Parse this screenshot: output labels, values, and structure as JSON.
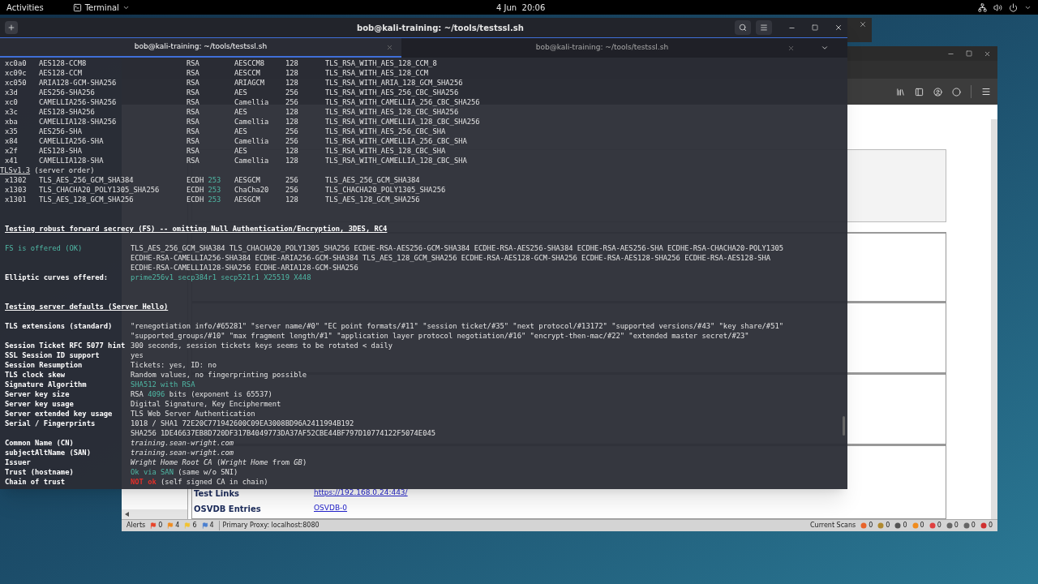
{
  "top_bar": {
    "activities": "Activities",
    "app_menu": "Terminal",
    "clock": "4 Jun  20:06"
  },
  "terminal": {
    "title": "bob@kali-training: ~/tools/testssl.sh",
    "tabs": [
      {
        "title": "bob@kali-training: ~/tools/testssl.sh",
        "selected": true
      },
      {
        "title": "bob@kali-training: ~/tools/testssl.sh",
        "selected": false
      }
    ],
    "lines": [
      {
        "kind": "cipher",
        "hex": "xc0a0",
        "name": "AES128-CCM8",
        "kx": "RSA",
        "enc": "AESCCM8",
        "bits": "128",
        "iana": "TLS_RSA_WITH_AES_128_CCM_8"
      },
      {
        "kind": "cipher",
        "hex": "xc09c",
        "name": "AES128-CCM",
        "kx": "RSA",
        "enc": "AESCCM",
        "bits": "128",
        "iana": "TLS_RSA_WITH_AES_128_CCM"
      },
      {
        "kind": "cipher",
        "hex": "xc050",
        "name": "ARIA128-GCM-SHA256",
        "kx": "RSA",
        "enc": "ARIAGCM",
        "bits": "128",
        "iana": "TLS_RSA_WITH_ARIA_128_GCM_SHA256"
      },
      {
        "kind": "cipher",
        "hex": "x3d",
        "name": "AES256-SHA256",
        "kx": "RSA",
        "enc": "AES",
        "bits": "256",
        "iana": "TLS_RSA_WITH_AES_256_CBC_SHA256"
      },
      {
        "kind": "cipher",
        "hex": "xc0",
        "name": "CAMELLIA256-SHA256",
        "kx": "RSA",
        "enc": "Camellia",
        "bits": "256",
        "iana": "TLS_RSA_WITH_CAMELLIA_256_CBC_SHA256"
      },
      {
        "kind": "cipher",
        "hex": "x3c",
        "name": "AES128-SHA256",
        "kx": "RSA",
        "enc": "AES",
        "bits": "128",
        "iana": "TLS_RSA_WITH_AES_128_CBC_SHA256"
      },
      {
        "kind": "cipher",
        "hex": "xba",
        "name": "CAMELLIA128-SHA256",
        "kx": "RSA",
        "enc": "Camellia",
        "bits": "128",
        "iana": "TLS_RSA_WITH_CAMELLIA_128_CBC_SHA256"
      },
      {
        "kind": "cipher",
        "hex": "x35",
        "name": "AES256-SHA",
        "kx": "RSA",
        "enc": "AES",
        "bits": "256",
        "iana": "TLS_RSA_WITH_AES_256_CBC_SHA"
      },
      {
        "kind": "cipher",
        "hex": "x84",
        "name": "CAMELLIA256-SHA",
        "kx": "RSA",
        "enc": "Camellia",
        "bits": "256",
        "iana": "TLS_RSA_WITH_CAMELLIA_256_CBC_SHA"
      },
      {
        "kind": "cipher",
        "hex": "x2f",
        "name": "AES128-SHA",
        "kx": "RSA",
        "enc": "AES",
        "bits": "128",
        "iana": "TLS_RSA_WITH_AES_128_CBC_SHA"
      },
      {
        "kind": "cipher",
        "hex": "x41",
        "name": "CAMELLIA128-SHA",
        "kx": "RSA",
        "enc": "Camellia",
        "bits": "128",
        "iana": "TLS_RSA_WITH_CAMELLIA_128_CBC_SHA"
      },
      {
        "kind": "label",
        "text": "TLSv1.3",
        "suffix": " (server order)"
      },
      {
        "kind": "cipher",
        "hex": "x1302",
        "name": "TLS_AES_256_GCM_SHA384",
        "kx": "ECDH",
        "curve": "253",
        "enc": "AESGCM",
        "bits": "256",
        "iana": "TLS_AES_256_GCM_SHA384"
      },
      {
        "kind": "cipher",
        "hex": "x1303",
        "name": "TLS_CHACHA20_POLY1305_SHA256",
        "kx": "ECDH",
        "curve": "253",
        "enc": "ChaCha20",
        "bits": "256",
        "iana": "TLS_CHACHA20_POLY1305_SHA256"
      },
      {
        "kind": "cipher",
        "hex": "x1301",
        "name": "TLS_AES_128_GCM_SHA256",
        "kx": "ECDH",
        "curve": "253",
        "enc": "AESGCM",
        "bits": "128",
        "iana": "TLS_AES_128_GCM_SHA256"
      },
      {
        "kind": "blank"
      },
      {
        "kind": "blank"
      },
      {
        "kind": "heading",
        "text": "Testing robust forward secrecy (FS) -- omitting Null Authentication/Encryption, 3DES, RC4"
      },
      {
        "kind": "blank"
      },
      {
        "kind": "kv",
        "key": "FS is offered (OK)",
        "key_highlighted": true,
        "values": [
          [
            {
              "text": "TLS_AES_256_GCM_SHA384 TLS_CHACHA20_POLY1305_SHA256 ECDHE-RSA-AES256-GCM-SHA384 ECDHE-RSA-AES256-SHA384 ECDHE-RSA-AES256-SHA ECDHE-RSA-CHACHA20-POLY1305",
              "kind": "plain"
            }
          ],
          [
            {
              "text": "ECDHE-RSA-CAMELLIA256-SHA384 ECDHE-ARIA256-GCM-SHA384 TLS_AES_128_GCM_SHA256 ECDHE-RSA-AES128-GCM-SHA256 ECDHE-RSA-AES128-SHA256 ECDHE-RSA-AES128-SHA",
              "kind": "plain"
            }
          ],
          [
            {
              "text": "ECDHE-RSA-CAMELLIA128-SHA256 ECDHE-ARIA128-GCM-SHA256",
              "kind": "plain"
            }
          ]
        ]
      },
      {
        "kind": "kv",
        "key": "Elliptic curves offered:",
        "key_highlighted": false,
        "values": [
          [
            {
              "text": "prime256v1 secp384r1 secp521r1 X25519 X448",
              "kind": "good"
            }
          ]
        ]
      },
      {
        "kind": "blank"
      },
      {
        "kind": "blank"
      },
      {
        "kind": "heading",
        "text": "Testing server defaults (Server Hello)"
      },
      {
        "kind": "blank"
      },
      {
        "kind": "kv",
        "key": "TLS extensions (standard)",
        "key_highlighted": false,
        "values": [
          [
            {
              "text": "\"renegotiation info/#65281\" \"server name/#0\" \"EC point formats/#11\" \"session ticket/#35\" \"next protocol/#13172\" \"supported versions/#43\" \"key share/#51\"",
              "kind": "plain"
            }
          ],
          [
            {
              "text": "\"supported_groups/#10\" \"max fragment length/#1\" \"application layer protocol negotiation/#16\" \"encrypt-then-mac/#22\" \"extended master secret/#23\"",
              "kind": "plain"
            }
          ]
        ]
      },
      {
        "kind": "kv",
        "key": "Session Ticket RFC 5077 hint",
        "key_highlighted": false,
        "values": [
          [
            {
              "text": "300 seconds, session tickets keys seems to be rotated < daily",
              "kind": "plain"
            }
          ]
        ]
      },
      {
        "kind": "kv",
        "key": "SSL Session ID support",
        "key_highlighted": false,
        "values": [
          [
            {
              "text": "yes",
              "kind": "plain"
            }
          ]
        ]
      },
      {
        "kind": "kv",
        "key": "Session Resumption",
        "key_highlighted": false,
        "values": [
          [
            {
              "text": "Tickets: yes, ID: no",
              "kind": "plain"
            }
          ]
        ]
      },
      {
        "kind": "kv",
        "key": "TLS clock skew",
        "key_highlighted": false,
        "values": [
          [
            {
              "text": "Random values, no fingerprinting possible",
              "kind": "plain"
            }
          ]
        ]
      },
      {
        "kind": "kv",
        "key": "Signature Algorithm",
        "key_highlighted": false,
        "values": [
          [
            {
              "text": "SHA512 with RSA",
              "kind": "good"
            }
          ]
        ]
      },
      {
        "kind": "kv",
        "key": "Server key size",
        "key_highlighted": false,
        "values": [
          [
            {
              "text": "RSA ",
              "kind": "plain"
            },
            {
              "text": "4096",
              "kind": "good"
            },
            {
              "text": " bits (exponent is 65537)",
              "kind": "plain"
            }
          ]
        ]
      },
      {
        "kind": "kv",
        "key": "Server key usage",
        "key_highlighted": false,
        "values": [
          [
            {
              "text": "Digital Signature, Key Encipherment",
              "kind": "plain"
            }
          ]
        ]
      },
      {
        "kind": "kv",
        "key": "Server extended key usage",
        "key_highlighted": false,
        "values": [
          [
            {
              "text": "TLS Web Server Authentication",
              "kind": "plain"
            }
          ]
        ]
      },
      {
        "kind": "kv",
        "key": "Serial / Fingerprints",
        "key_highlighted": false,
        "values": [
          [
            {
              "text": "1018 / SHA1 72E20C771942600C09EA3008BD96A2411994B192",
              "kind": "plain"
            }
          ],
          [
            {
              "text": "SHA256 1DE46637EB8D720DF317B4049773DA37AF52CBE44BF797D10774122F5074E045",
              "kind": "plain"
            }
          ]
        ]
      },
      {
        "kind": "kv",
        "key": "Common Name (CN)",
        "key_highlighted": false,
        "values": [
          [
            {
              "text": "training.sean-wright.com",
              "kind": "italic"
            }
          ]
        ]
      },
      {
        "kind": "kv",
        "key": "subjectAltName (SAN)",
        "key_highlighted": false,
        "values": [
          [
            {
              "text": "training.sean-wright.com",
              "kind": "italic"
            }
          ]
        ]
      },
      {
        "kind": "kv",
        "key": "Issuer",
        "key_highlighted": false,
        "values": [
          [
            {
              "text": "Wright Home Root CA",
              "kind": "italic"
            },
            {
              "text": " (",
              "kind": "plain"
            },
            {
              "text": "Wright Home",
              "kind": "italic"
            },
            {
              "text": " from ",
              "kind": "plain"
            },
            {
              "text": "GB",
              "kind": "italic"
            },
            {
              "text": ")",
              "kind": "plain"
            }
          ]
        ]
      },
      {
        "kind": "kv",
        "key": "Trust (hostname)",
        "key_highlighted": false,
        "values": [
          [
            {
              "text": "Ok via SAN",
              "kind": "good"
            },
            {
              "text": " (same w/o SNI)",
              "kind": "plain"
            }
          ]
        ]
      },
      {
        "kind": "kv",
        "key": "Chain of trust",
        "key_highlighted": false,
        "values": [
          [
            {
              "text": "NOT ok",
              "kind": "bad"
            },
            {
              "text": " (self signed CA in chain)",
              "kind": "plain"
            }
          ]
        ]
      }
    ]
  },
  "scanner": {
    "report_rows": [
      {
        "label": "Test Links",
        "links": [
          "https://192.168.0.24:443/"
        ]
      },
      {
        "label": "OSVDB Entries",
        "links": [
          "OSVDB-0"
        ]
      }
    ],
    "status_bar": {
      "alerts_label": "Alerts",
      "alerts": [
        {
          "count": "0",
          "color": "#e8442a"
        },
        {
          "count": "4",
          "color": "#f08c1e"
        },
        {
          "count": "6",
          "color": "#f2c230"
        },
        {
          "count": "4",
          "color": "#4a7fd0"
        }
      ],
      "proxy": "Primary Proxy: localhost:8080",
      "scans_label": "Current Scans",
      "scans": [
        "0",
        "0",
        "0",
        "0",
        "0",
        "0",
        "0",
        "0"
      ]
    }
  }
}
